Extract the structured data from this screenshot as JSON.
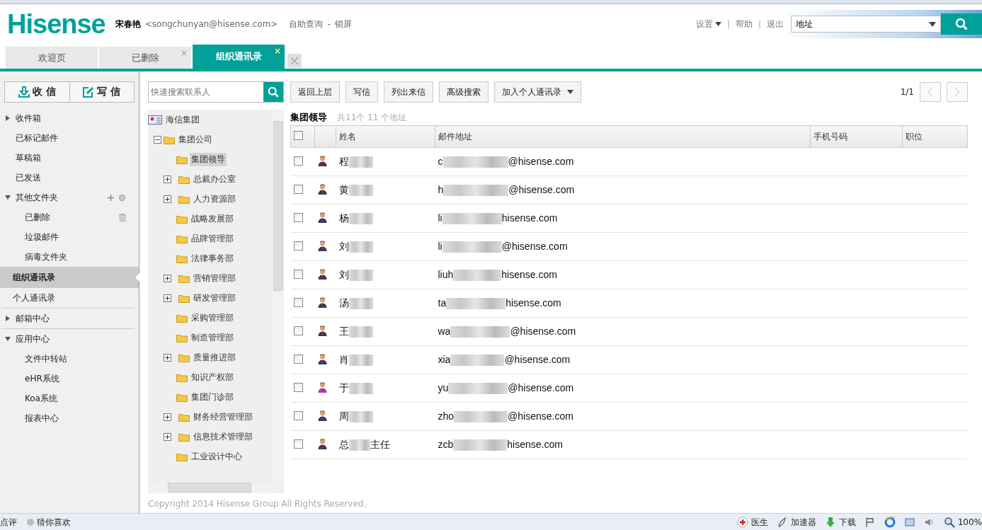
{
  "header": {
    "logo": "Hisense",
    "user_name": "宋春艳",
    "user_email": "<songchunyan@hisense.com>",
    "links": [
      "自助查询",
      "-",
      "锁屏"
    ],
    "menu": [
      {
        "label": "设置",
        "kind": "dropdown"
      },
      {
        "label": "|",
        "kind": "sep"
      },
      {
        "label": "帮助",
        "kind": "link"
      },
      {
        "label": "|",
        "kind": "sep"
      },
      {
        "label": "退出",
        "kind": "link"
      }
    ],
    "search_scope": "地址"
  },
  "tabs": [
    {
      "label": "欢迎页",
      "selected": false
    },
    {
      "label": "已删除",
      "selected": false,
      "close": "×"
    },
    {
      "label": "组织通讯录",
      "selected": true,
      "close": "×"
    }
  ],
  "sidebar": {
    "buttons": [
      "收 信",
      "写 信"
    ],
    "items": [
      {
        "label": "收件箱",
        "kind": "group",
        "expanded": false,
        "selected": false
      },
      {
        "label": "已标记邮件",
        "kind": "item",
        "selected": false
      },
      {
        "label": "草稿箱",
        "kind": "item",
        "selected": false
      },
      {
        "label": "已发送",
        "kind": "item",
        "selected": false
      },
      {
        "label": "其他文件夹",
        "kind": "group",
        "expanded": true,
        "selected": false,
        "tools": true,
        "children": [
          {
            "label": "已删除",
            "trash": true,
            "selected": false
          },
          {
            "label": "垃圾邮件",
            "trash": false,
            "selected": false
          },
          {
            "label": "病毒文件夹",
            "trash": false,
            "selected": false
          }
        ]
      },
      {
        "label": "组织通讯录",
        "kind": "section",
        "selected": true
      },
      {
        "label": "个人通讯录",
        "kind": "section",
        "selected": false
      },
      {
        "label": "邮箱中心",
        "kind": "group",
        "expanded": false,
        "selected": false
      },
      {
        "label": "应用中心",
        "kind": "group",
        "expanded": true,
        "selected": false,
        "children": [
          {
            "label": "文件中转站",
            "trash": false,
            "selected": false
          },
          {
            "label": "eHR系统",
            "trash": false,
            "selected": false
          },
          {
            "label": "Koa系统",
            "trash": false,
            "selected": false
          },
          {
            "label": "报表中心",
            "trash": false,
            "selected": false
          }
        ]
      }
    ]
  },
  "tree": {
    "search_placeholder": "快速搜索联系人",
    "root": "海信集团",
    "nodes": [
      {
        "label": "集团公司",
        "expanded": true,
        "children": [
          {
            "label": "集团领导",
            "selected": true,
            "has_children": false
          },
          {
            "label": "总裁办公室",
            "selected": false,
            "has_children": true
          },
          {
            "label": "人力资源部",
            "selected": false,
            "has_children": true
          },
          {
            "label": "战略发展部",
            "selected": false,
            "has_children": false
          },
          {
            "label": "品牌管理部",
            "selected": false,
            "has_children": false
          },
          {
            "label": "法律事务部",
            "selected": false,
            "has_children": false
          },
          {
            "label": "营销管理部",
            "selected": false,
            "has_children": true
          },
          {
            "label": "研发管理部",
            "selected": false,
            "has_children": true
          },
          {
            "label": "采购管理部",
            "selected": false,
            "has_children": false
          },
          {
            "label": "制造管理部",
            "selected": false,
            "has_children": false
          },
          {
            "label": "质量推进部",
            "selected": false,
            "has_children": true
          },
          {
            "label": "知识产权部",
            "selected": false,
            "has_children": false
          },
          {
            "label": "集团门诊部",
            "selected": false,
            "has_children": false
          },
          {
            "label": "财务经营管理部",
            "selected": false,
            "has_children": true
          },
          {
            "label": "信息技术管理部",
            "selected": false,
            "has_children": true
          },
          {
            "label": "工业设计中心",
            "selected": false,
            "has_children": false
          }
        ]
      }
    ]
  },
  "toolbar": [
    {
      "label": "返回上层",
      "kind": "button"
    },
    {
      "label": "写信",
      "kind": "button"
    },
    {
      "label": "列出来信",
      "kind": "button"
    },
    {
      "label": "高级搜索",
      "kind": "button"
    },
    {
      "label": "加入个人通讯录",
      "kind": "dropdown"
    }
  ],
  "pager": "1/1",
  "group": {
    "title": "集团领导",
    "count": "共11个 11 个地址"
  },
  "table": {
    "all_checked": false,
    "columns": [
      "姓名",
      "邮件地址",
      "手机号码",
      "职位"
    ],
    "rows": [
      {
        "kind": "male",
        "checked": false,
        "name_start": "程",
        "name_end": "",
        "email_start": "c",
        "email_end": "@hisense.com"
      },
      {
        "kind": "male",
        "checked": false,
        "name_start": "黄",
        "name_end": "",
        "email_start": "h",
        "email_end": "@hisense.com"
      },
      {
        "kind": "male",
        "checked": false,
        "name_start": "杨",
        "name_end": "",
        "email_start": "li",
        "email_end": "hisense.com"
      },
      {
        "kind": "male",
        "checked": false,
        "name_start": "刘",
        "name_end": "",
        "email_start": "li",
        "email_end": "@hisense.com"
      },
      {
        "kind": "male",
        "checked": false,
        "name_start": "刘",
        "name_end": "",
        "email_start": "liuh",
        "email_end": "hisense.com"
      },
      {
        "kind": "male",
        "checked": false,
        "name_start": "汤",
        "name_end": "",
        "email_start": "ta",
        "email_end": "hisense.com"
      },
      {
        "kind": "male",
        "checked": false,
        "name_start": "王",
        "name_end": "",
        "email_start": "wa",
        "email_end": "@hisense.com"
      },
      {
        "kind": "male",
        "checked": false,
        "name_start": "肖",
        "name_end": "",
        "email_start": "xia",
        "email_end": "@hisense.com"
      },
      {
        "kind": "female",
        "checked": false,
        "name_start": "于",
        "name_end": "",
        "email_start": "yu",
        "email_end": "@hisense.com"
      },
      {
        "kind": "male",
        "checked": false,
        "name_start": "周",
        "name_end": "",
        "email_start": "zho",
        "email_end": "@hisense.com"
      },
      {
        "kind": "male",
        "checked": false,
        "name_start": "总",
        "name_end": "主任",
        "email_start": "zcb",
        "email_end": "hisense.com"
      }
    ]
  },
  "copyright": "Copyright 2014 Hisense Group All Rights Reserved.",
  "status_bar": {
    "left": [
      "点评",
      "猜你喜欢"
    ],
    "right": [
      {
        "label": "医生",
        "kind": "doctor"
      },
      {
        "label": "加速器",
        "kind": "rocket"
      },
      {
        "label": "下载",
        "kind": "download"
      },
      {
        "kind": "flag"
      },
      {
        "kind": "ie"
      },
      {
        "kind": "window"
      },
      {
        "kind": "sound"
      },
      {
        "label": "100%",
        "kind": "zoom"
      }
    ]
  }
}
